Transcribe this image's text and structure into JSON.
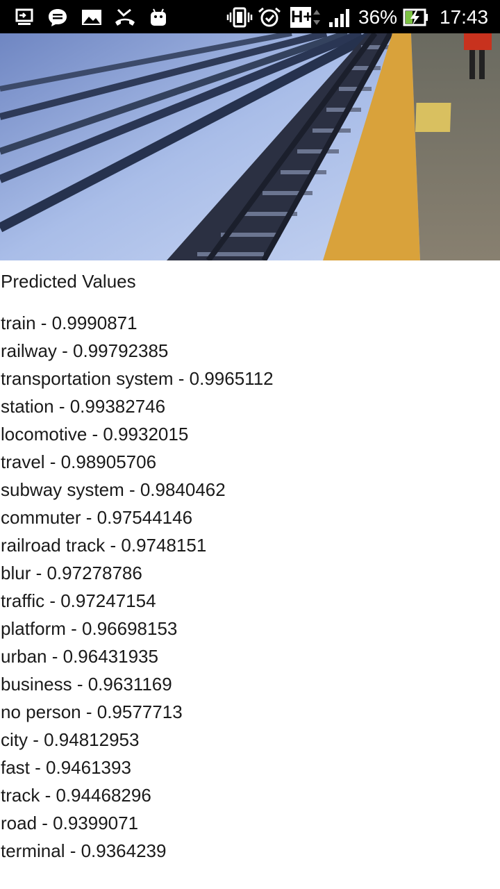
{
  "status_bar": {
    "battery_percent": "36%",
    "time": "17:43",
    "network_type": "H+",
    "icons": [
      "screen-cast-icon",
      "message-icon",
      "gallery-icon",
      "missed-call-icon",
      "android-icon",
      "vibrate-icon",
      "alarm-icon",
      "network-h-plus-icon",
      "signal-icon",
      "battery-charging-icon"
    ]
  },
  "heading": "Predicted Values",
  "predictions": [
    {
      "text": "train - 0.9990871"
    },
    {
      "text": "railway - 0.99792385"
    },
    {
      "text": "transportation system - 0.9965112"
    },
    {
      "text": "station - 0.99382746"
    },
    {
      "text": "locomotive - 0.9932015"
    },
    {
      "text": "travel - 0.98905706"
    },
    {
      "text": "subway system - 0.9840462"
    },
    {
      "text": "commuter - 0.97544146"
    },
    {
      "text": "railroad track - 0.9748151"
    },
    {
      "text": "blur - 0.97278786"
    },
    {
      "text": "traffic - 0.97247154"
    },
    {
      "text": "platform - 0.96698153"
    },
    {
      "text": "urban - 0.96431935"
    },
    {
      "text": "business - 0.9631169"
    },
    {
      "text": "no person - 0.9577713"
    },
    {
      "text": "city - 0.94812953"
    },
    {
      "text": "fast - 0.9461393"
    },
    {
      "text": "track - 0.94468296"
    },
    {
      "text": "road - 0.9399071"
    },
    {
      "text": "terminal - 0.9364239"
    }
  ]
}
